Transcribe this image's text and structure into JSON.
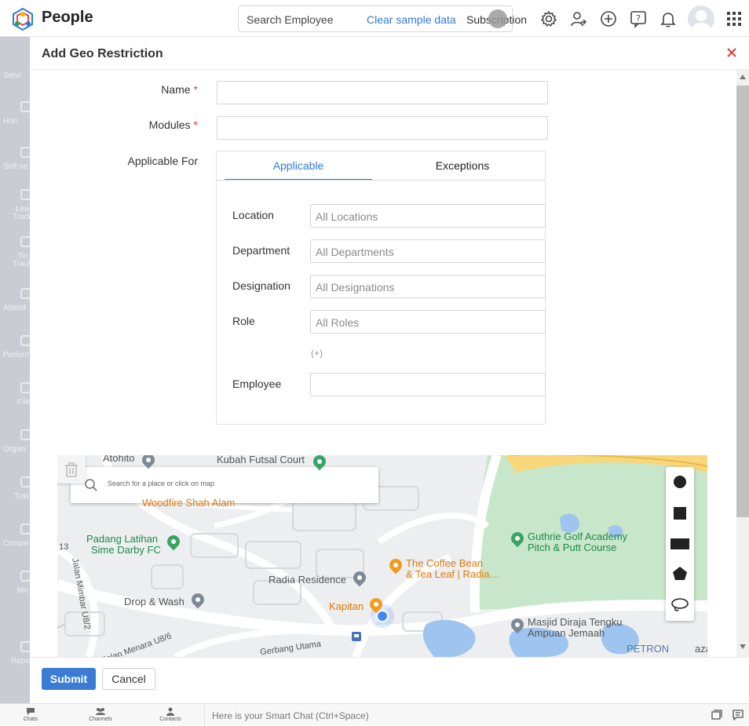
{
  "app": {
    "name": "People"
  },
  "header": {
    "search_placeholder": "Search Employee",
    "clear_sample": "Clear sample data",
    "subscription": "Subscription"
  },
  "sidebar": {
    "items": [
      {
        "label": "Servi",
        "icon": "services-icon"
      },
      {
        "label": "Hon",
        "icon": "home-icon"
      },
      {
        "label": "Self-se",
        "icon": "self-service-icon"
      },
      {
        "label": "Lea",
        "label2": "Track",
        "icon": "leave-icon"
      },
      {
        "label": "Tin",
        "label2": "Track",
        "icon": "time-icon"
      },
      {
        "label": "Attend",
        "icon": "attendance-icon"
      },
      {
        "label": "Perform",
        "icon": "performance-icon"
      },
      {
        "label": "File",
        "icon": "files-icon"
      },
      {
        "label": "Organi",
        "icon": "organization-icon"
      },
      {
        "label": "Trav",
        "icon": "travel-icon"
      },
      {
        "label": "Compe",
        "icon": "compensation-icon"
      },
      {
        "label": "Mo",
        "icon": "more-icon"
      },
      {
        "label": "Repo",
        "icon": "reports-icon"
      }
    ]
  },
  "dialog": {
    "title": "Add Geo Restriction",
    "name_label": "Name",
    "modules_label": "Modules",
    "required_mark": "*",
    "applicable_for_label": "Applicable For",
    "tabs": {
      "applicable": "Applicable",
      "exceptions": "Exceptions"
    },
    "criteria": {
      "location_label": "Location",
      "location_placeholder": "All Locations",
      "department_label": "Department",
      "department_placeholder": "All Departments",
      "designation_label": "Designation",
      "designation_placeholder": "All Designations",
      "role_label": "Role",
      "role_placeholder": "All Roles",
      "add_more": "(+)",
      "employee_label": "Employee"
    },
    "map": {
      "search_placeholder": "Search for a place or click on map",
      "labels": {
        "atohito": "Atohito",
        "kubah": "Kubah Futsal Court",
        "woodfire": "Woodfire Shah Alam",
        "padang1": "Padang Latihan",
        "padang2": "Sime Darby FC",
        "guthrie1": "Guthrie Golf Academy",
        "guthrie2": "Pitch & Putt Course",
        "coffee1": "The Coffee Bean",
        "coffee2": "& Tea Leaf | Radia…",
        "radia": "Radia Residence",
        "kapitan": "Kapitan",
        "drop": "Drop & Wash",
        "masjid1": "Masjid Diraja Tengku",
        "masjid2": "Ampuan Jemaah",
        "petron": "PETRON",
        "petron_tail": "aza",
        "road_mimbar": "Jalan Mimbar U8/2",
        "road_menara": "Jalan Menara U8/6",
        "road_gerbang": "Gerbang Utama",
        "road_13": "13"
      }
    },
    "submit": "Submit",
    "cancel": "Cancel"
  },
  "bottombar": {
    "chats": "Chats",
    "channels": "Channels",
    "contacts": "Contacts",
    "smartchat_placeholder": "Here is your Smart Chat (Ctrl+Space)"
  }
}
